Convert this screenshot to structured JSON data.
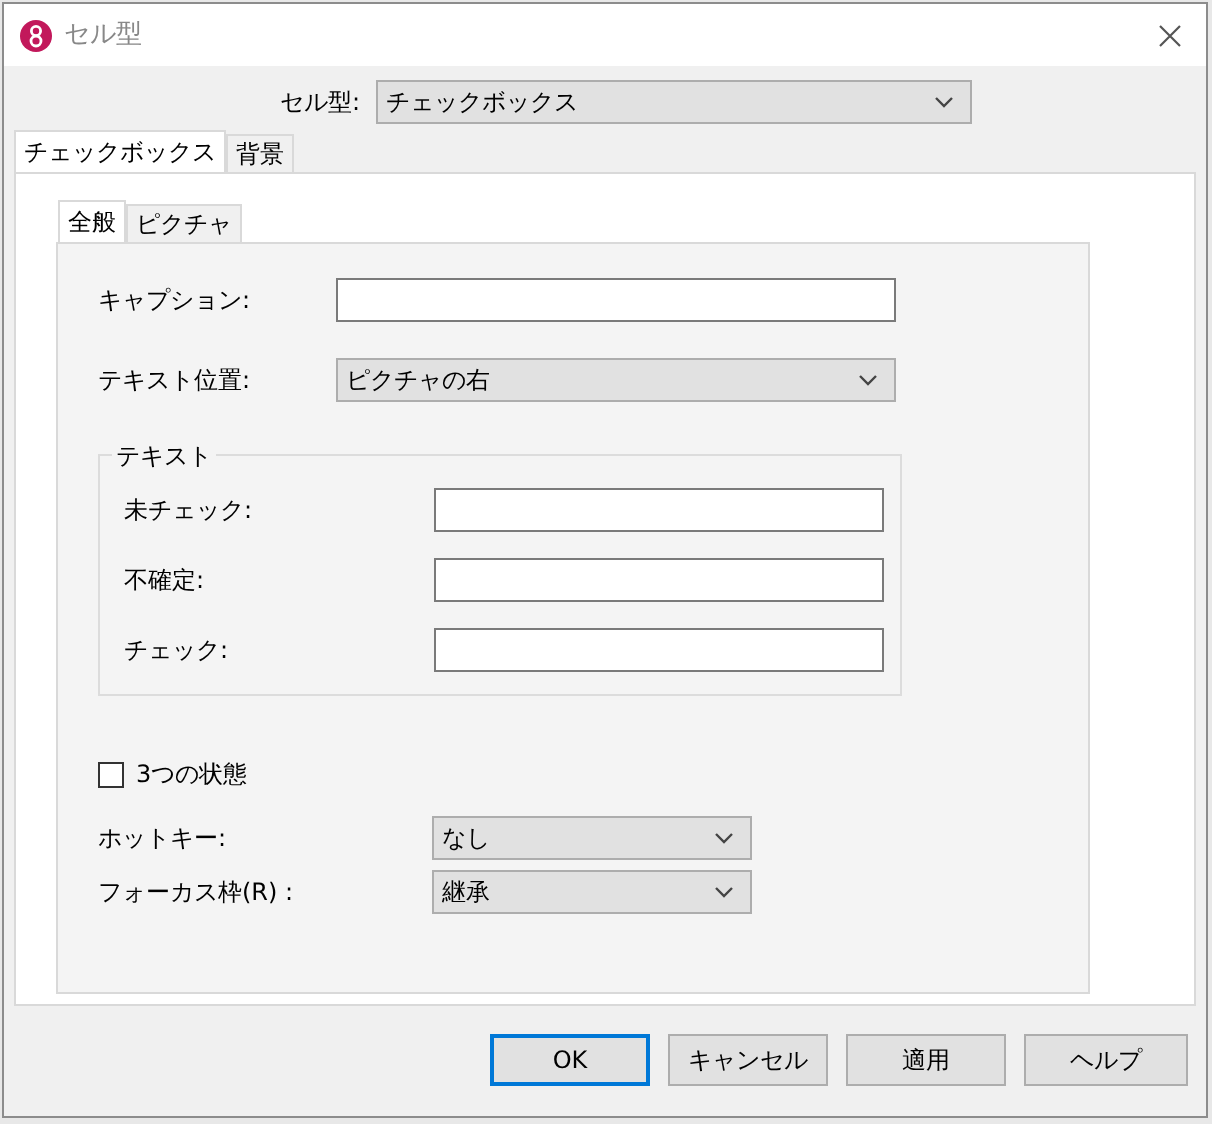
{
  "window": {
    "title": "セル型"
  },
  "cell_type": {
    "label": "セル型:",
    "value": "チェックボックス"
  },
  "tabs": [
    {
      "label": "チェックボックス",
      "selected": true
    },
    {
      "label": "背景",
      "selected": false
    }
  ],
  "sub_tabs": [
    {
      "label": "全般",
      "selected": true
    },
    {
      "label": "ピクチャ",
      "selected": false
    }
  ],
  "caption": {
    "label": "キャプション:"
  },
  "text_position": {
    "label": "テキスト位置:",
    "value": "ピクチャの右"
  },
  "text_group": {
    "title": "テキスト",
    "fields": [
      {
        "label": "未チェック:"
      },
      {
        "label": "不確定:"
      },
      {
        "label": "チェック:"
      }
    ]
  },
  "three_state": {
    "label": "3つの状態",
    "checked": false
  },
  "hotkey": {
    "label": "ホットキー:",
    "value": "なし"
  },
  "focus_frame": {
    "label": "フォーカス枠(R) :",
    "value": "継承"
  },
  "buttons": [
    {
      "label": "OK",
      "default": true
    },
    {
      "label": "キャンセル",
      "default": false
    },
    {
      "label": "適用",
      "default": false
    },
    {
      "label": "ヘルプ",
      "default": false
    }
  ]
}
